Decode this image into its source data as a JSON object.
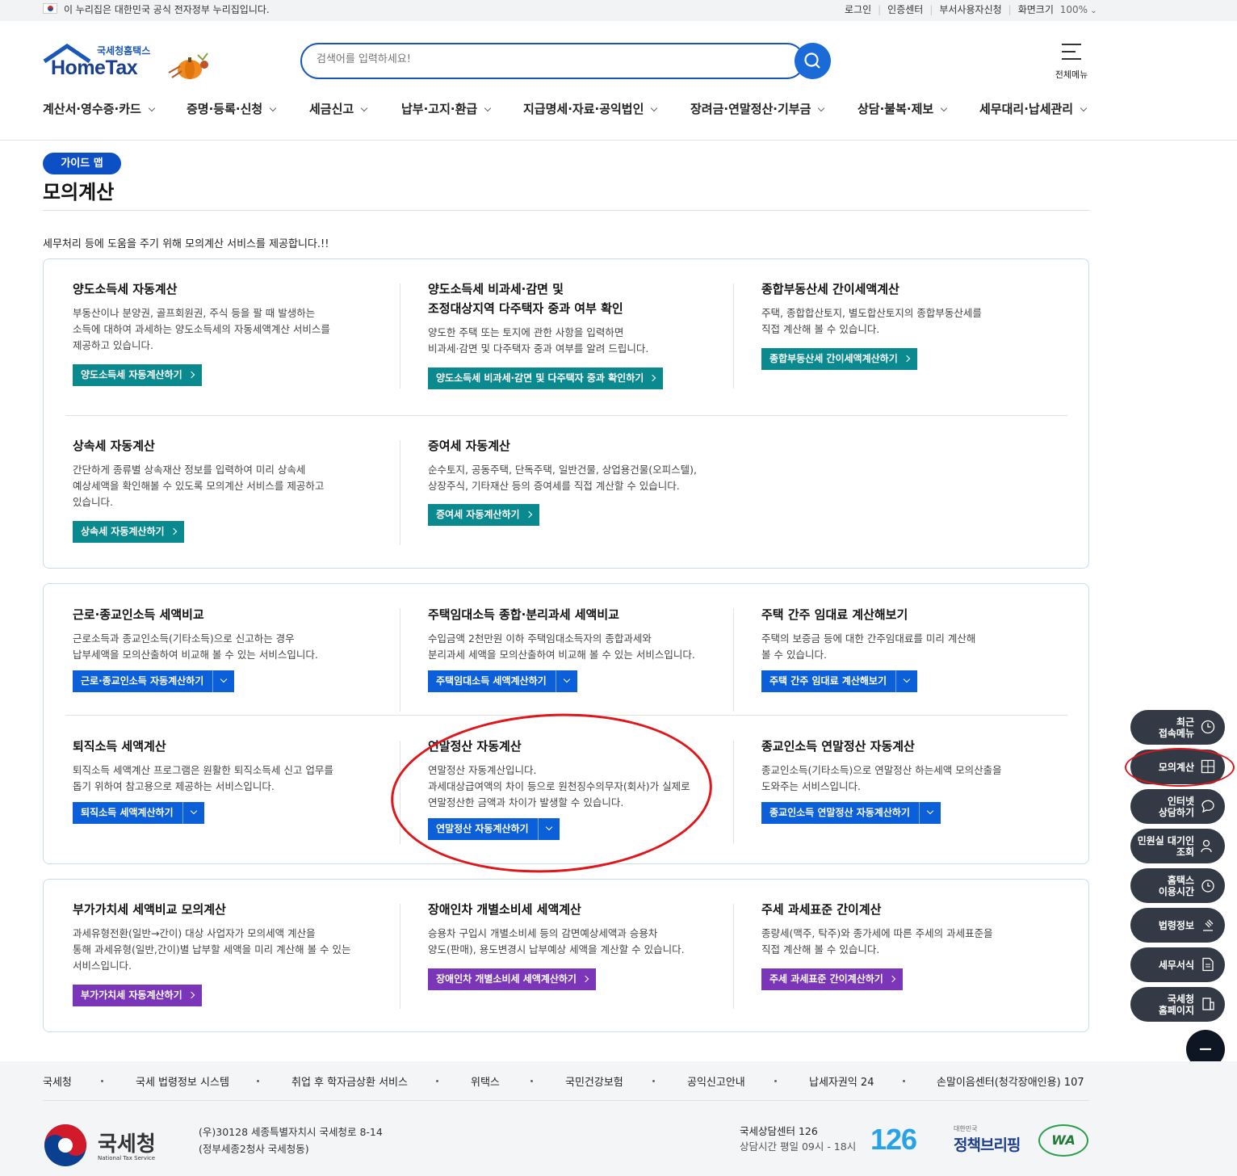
{
  "govbar": {
    "notice": "이 누리집은 대한민국 공식 전자정부 누리집입니다.",
    "links": [
      "로그인",
      "인증센터",
      "부서사용자신청",
      "화면크기"
    ],
    "zoom": "100%"
  },
  "header": {
    "logo_sub": "국세청홈택스",
    "logo_main": "HomeTax",
    "search_placeholder": "검색어를 입력하세요!",
    "allmenu_label": "전체메뉴"
  },
  "gnb": [
    "계산서·영수증·카드",
    "증명·등록·신청",
    "세금신고",
    "납부·고지·환급",
    "지급명세·자료·공익법인",
    "장려금·연말정산·기부금",
    "상담·불복·제보",
    "세무대리·납세관리"
  ],
  "page": {
    "badge": "가이드 맵",
    "title": "모의계산",
    "intro": "세무처리 등에 도움을 주기 위해 모의계산 서비스를 제공합니다.!!"
  },
  "cards": [
    {
      "title": "양도소득세 자동계산",
      "desc": "부동산이나 분양권, 골프회원권, 주식 등을 팔 때 발생하는\n소득에 대하여 과세하는 양도소득세의 자동세액계산 서비스를\n제공하고 있습니다.",
      "button": "양도소득세 자동계산하기"
    },
    {
      "title": "양도소득세 비과세·감면 및\n조정대상지역 다주택자 중과 여부 확인",
      "desc": "양도한 주택 또는 토지에 관한 사항을 입력하면\n비과세·감면 및 다주택자 중과 여부를 알려 드립니다.",
      "button": "양도소득세 비과세·감면 및 다주택자 중과 확인하기"
    },
    {
      "title": "종합부동산세 간이세액계산",
      "desc": "주택, 종합합산토지, 별도합산토지의 종합부동산세를\n직접 계산해 볼 수 있습니다.",
      "button": "종합부동산세 간이세액계산하기"
    },
    {
      "title": "상속세 자동계산",
      "desc": "간단하게 종류별 상속재산 정보를 입력하여 미리 상속세\n예상세액을 확인해볼 수 있도록 모의계산 서비스를 제공하고\n있습니다.",
      "button": "상속세 자동계산하기"
    },
    {
      "title": "증여세 자동계산",
      "desc": "순수토지, 공동주택, 단독주택, 일반건물, 상업용건물(오피스텔),\n상장주식, 기타재산 등의 증여세를 직접 계산할 수 있습니다.",
      "button": "증여세 자동계산하기"
    },
    {
      "title": "근로·종교인소득 세액비교",
      "desc": "근로소득과 종교인소득(기타소득)으로 신고하는 경우\n납부세액을 모의산출하여 비교해 볼 수 있는 서비스입니다.",
      "button": "근로·종교인소득 자동계산하기"
    },
    {
      "title": "주택임대소득 종합·분리과세 세액비교",
      "desc": "수입금액 2천만원 이하 주택임대소득자의 종합과세와\n분리과세 세액을 모의산출하여 비교해 볼 수 있는 서비스입니다.",
      "button": "주택임대소득 세액계산하기"
    },
    {
      "title": "주택 간주 임대료 계산해보기",
      "desc": "주택의 보증금 등에 대한 간주임대료를 미리 계산해\n볼 수 있습니다.",
      "button": "주택 간주 임대료 계산해보기"
    },
    {
      "title": "퇴직소득 세액계산",
      "desc": "퇴직소득 세액계산 프로그램은 원활한 퇴직소득세 신고 업무를\n돕기 위하여 참고용으로 제공하는 서비스입니다.",
      "button": "퇴직소득 세액계산하기"
    },
    {
      "title": "연말정산 자동계산",
      "desc": "연말정산 자동계산입니다.\n과세대상급여액의 차이 등으로 원천징수의무자(회사)가 실제로\n연말정산한 금액과 차이가 발생할 수 있습니다.",
      "button": "연말정산 자동계산하기"
    },
    {
      "title": "종교인소득 연말정산 자동계산",
      "desc": "종교인소득(기타소득)으로 연말정산 하는세액 모의산출을\n도와주는 서비스입니다.",
      "button": "종교인소득 연말정산 자동계산하기"
    },
    {
      "title": "부가가치세 세액비교 모의계산",
      "desc": "과세유형전환(일반→간이) 대상 사업자가 모의세액 계산을\n통해 과세유형(일반,간이)별 납부할 세액을 미리 계산해 볼 수 있는\n서비스입니다.",
      "button": "부가가치세 자동계산하기"
    },
    {
      "title": "장애인차 개별소비세 세액계산",
      "desc": "승용차 구입시 개별소비세 등의 감면예상세액과 승용차\n양도(판매), 용도변경시 납부예상 세액을 계산할 수 있습니다.",
      "button": "장애인차 개별소비세 세액계산하기"
    },
    {
      "title": "주세 과세표준 간이계산",
      "desc": "종량세(맥주, 탁주)와 종가세에 따른 주세의 과세표준을\n직접 계산해 볼 수 있습니다.",
      "button": "주세 과세표준 간이계산하기"
    }
  ],
  "quick": [
    "최근\n접속메뉴",
    "모의계산",
    "인터넷\n상담하기",
    "민원실 대기인\n조회",
    "홈택스\n이용시간",
    "법령정보",
    "세무서식",
    "국세청\n홈페이지"
  ],
  "footer": {
    "links": [
      "국세청",
      "국세 법령정보 시스템",
      "취업 후 학자금상환 서비스",
      "위택스",
      "국민건강보험",
      "공익신고안내",
      "납세자권익 24",
      "손말이음센터(청각장애인용) 107"
    ],
    "org": "국세청",
    "org_en": "National Tax Service",
    "address1": "(우)30128 세종특별자치시 국세청로 8-14",
    "address2": "(정부세종2청사 국세청동)",
    "call_title": "국세상담센터 126",
    "call_hours": "상담시간 평일 09시 - 18시",
    "big_number": "126",
    "brief_small": "대한민국",
    "brief": "정책브리핑",
    "wa": "WA"
  },
  "colors": {
    "teal": "#0a8a8f",
    "blue": "#0b5fd8",
    "purple": "#7a35b8",
    "navy": "#1a57b8",
    "annotation": "#e0161b"
  }
}
